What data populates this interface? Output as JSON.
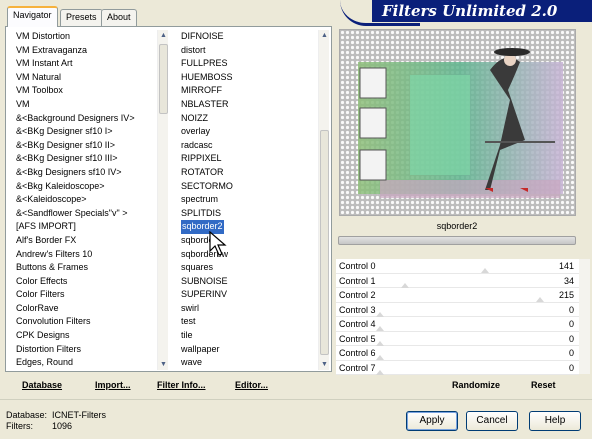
{
  "app": {
    "banner_title": "Filters Unlimited 2.0"
  },
  "tabs": [
    {
      "label": "Navigator",
      "active": true
    },
    {
      "label": "Presets",
      "active": false
    },
    {
      "label": "About",
      "active": false
    }
  ],
  "categories": {
    "items": [
      "VM Distortion",
      "VM Extravaganza",
      "VM Instant Art",
      "VM Natural",
      "VM Toolbox",
      "VM",
      "&<Background Designers IV>",
      "&<BKg Designer sf10 I>",
      "&<BKg Designer sf10 II>",
      "&<BKg Designer sf10 III>",
      "&<Bkg Designers sf10 IV>",
      "&<Bkg Kaleidoscope>",
      "&<Kaleidoscope>",
      "&<Sandflower Specials\"v\" >",
      "[AFS IMPORT]",
      "Alf's Border FX",
      "Andrew's Filters 10",
      "Buttons & Frames",
      "Color Effects",
      "Color Filters",
      "ColorRave",
      "Convolution Filters",
      "CPK Designs",
      "Distortion Filters",
      "Edges, Round"
    ]
  },
  "filters": {
    "items": [
      "DIFNOISE",
      "distort",
      "FULLPRES",
      "HUEMBOSS",
      "MIRROFF",
      "NBLASTER",
      "NOIZZ",
      "overlay",
      "radcasc",
      "RIPPIXEL",
      "ROTATOR",
      "SECTORMO",
      "spectrum",
      "SPLITDIS",
      "sqborder2",
      "sqborder",
      "sqborderbw",
      "squares",
      "SUBNOISE",
      "SUPERINV",
      "swirl",
      "test",
      "tile",
      "wallpaper",
      "wave"
    ],
    "selected": "sqborder2"
  },
  "preview": {
    "filter_name": "sqborder2"
  },
  "controls": [
    {
      "label": "Control 0",
      "value": "141",
      "level": 0.553
    },
    {
      "label": "Control 1",
      "value": "34",
      "level": 0.133
    },
    {
      "label": "Control 2",
      "value": "215",
      "level": 0.843
    },
    {
      "label": "Control 3",
      "value": "0",
      "level": 0
    },
    {
      "label": "Control 4",
      "value": "0",
      "level": 0
    },
    {
      "label": "Control 5",
      "value": "0",
      "level": 0
    },
    {
      "label": "Control 6",
      "value": "0",
      "level": 0
    },
    {
      "label": "Control 7",
      "value": "0",
      "level": 0
    }
  ],
  "toolbar": {
    "database": "Database",
    "import": "Import...",
    "filter_info": "Filter Info...",
    "editor": "Editor...",
    "randomize": "Randomize",
    "reset": "Reset"
  },
  "status": {
    "database_label": "Database:",
    "database_value": "ICNET-Filters",
    "filters_label": "Filters:",
    "filters_value": "1096"
  },
  "buttons": {
    "apply": "Apply",
    "cancel": "Cancel",
    "help": "Help"
  },
  "colors": {
    "banner": "#0a1f7a",
    "selection": "#316ac5",
    "tab_accent": "#f6b23d"
  },
  "icons": [
    "scroll-up-arrow",
    "scroll-down-arrow",
    "mouse-cursor"
  ]
}
